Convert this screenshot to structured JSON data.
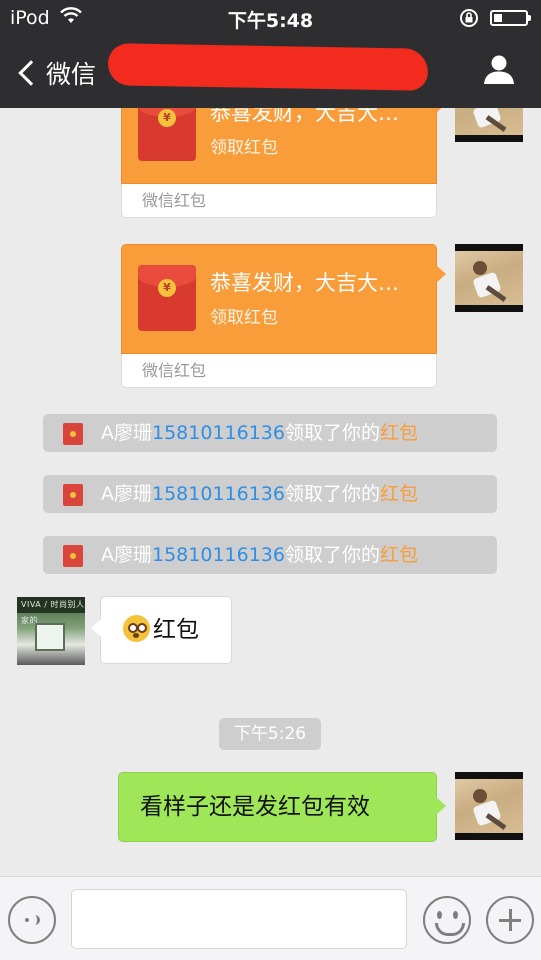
{
  "status_bar": {
    "carrier": "iPod",
    "time": "下午5:48"
  },
  "nav": {
    "back_label": "微信"
  },
  "messages": {
    "red_packets": [
      {
        "title": "恭喜发财，大吉大…",
        "action": "领取红包",
        "footer": "微信红包"
      },
      {
        "title": "恭喜发财，大吉大…",
        "action": "领取红包",
        "footer": "微信红包"
      }
    ],
    "notices": [
      {
        "name": "A廖珊",
        "phone": "15810116136",
        "mid": "领取了你的",
        "link": "红包"
      },
      {
        "name": "A廖珊",
        "phone": "15810116136",
        "mid": "领取了你的",
        "link": "红包"
      },
      {
        "name": "A廖珊",
        "phone": "15810116136",
        "mid": "领取了你的",
        "link": "红包"
      }
    ],
    "incoming_text": "红包",
    "incoming_avatar_sign": "VIVA / 时尚别人家的",
    "timestamp": "下午5:26",
    "outgoing_text": "看样子还是发红包有效"
  },
  "icons": {
    "wifi": "wifi-icon",
    "lock": "orientation-lock-icon",
    "battery": "battery-icon",
    "back": "chevron-left-icon",
    "profile": "person-icon",
    "voice": "voice-icon",
    "emoji": "smiley-icon",
    "plus": "plus-icon",
    "emoji_inline": "astonished-emoji-icon"
  },
  "colors": {
    "nav_bg": "#2e2e31",
    "red_packet": "#f99d3a",
    "outgoing_bubble": "#9fe658",
    "phone_link": "#2f8fe6",
    "redaction": "#f22b1e"
  }
}
